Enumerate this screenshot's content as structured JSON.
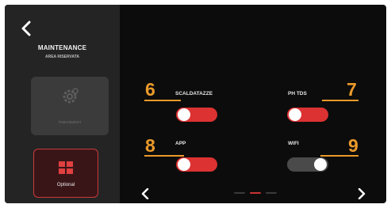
{
  "header": {
    "title": "MAINTENANCE",
    "subtitle": "AREA RISERVATA"
  },
  "sidebar": {
    "items": [
      {
        "label": "Impostazioni",
        "icon": "gear-icon",
        "selected": false
      },
      {
        "label": "Optional",
        "icon": "options-icon",
        "selected": true
      }
    ]
  },
  "options": [
    {
      "label": "SCALDATAZZE",
      "on": true,
      "callout": "6"
    },
    {
      "label": "PH TDS",
      "on": true,
      "callout": "7"
    },
    {
      "label": "APP",
      "on": true,
      "callout": "8"
    },
    {
      "label": "WIFI",
      "on": false,
      "callout": "9"
    }
  ],
  "pagination": {
    "page_count": 3,
    "active_page": 2
  },
  "colors": {
    "accent": "#dc3232",
    "callout": "#ea9a2a",
    "toggle_off": "#4a4a4a",
    "sidebar_bg": "#242424",
    "screen_bg": "#0c0c0c"
  }
}
